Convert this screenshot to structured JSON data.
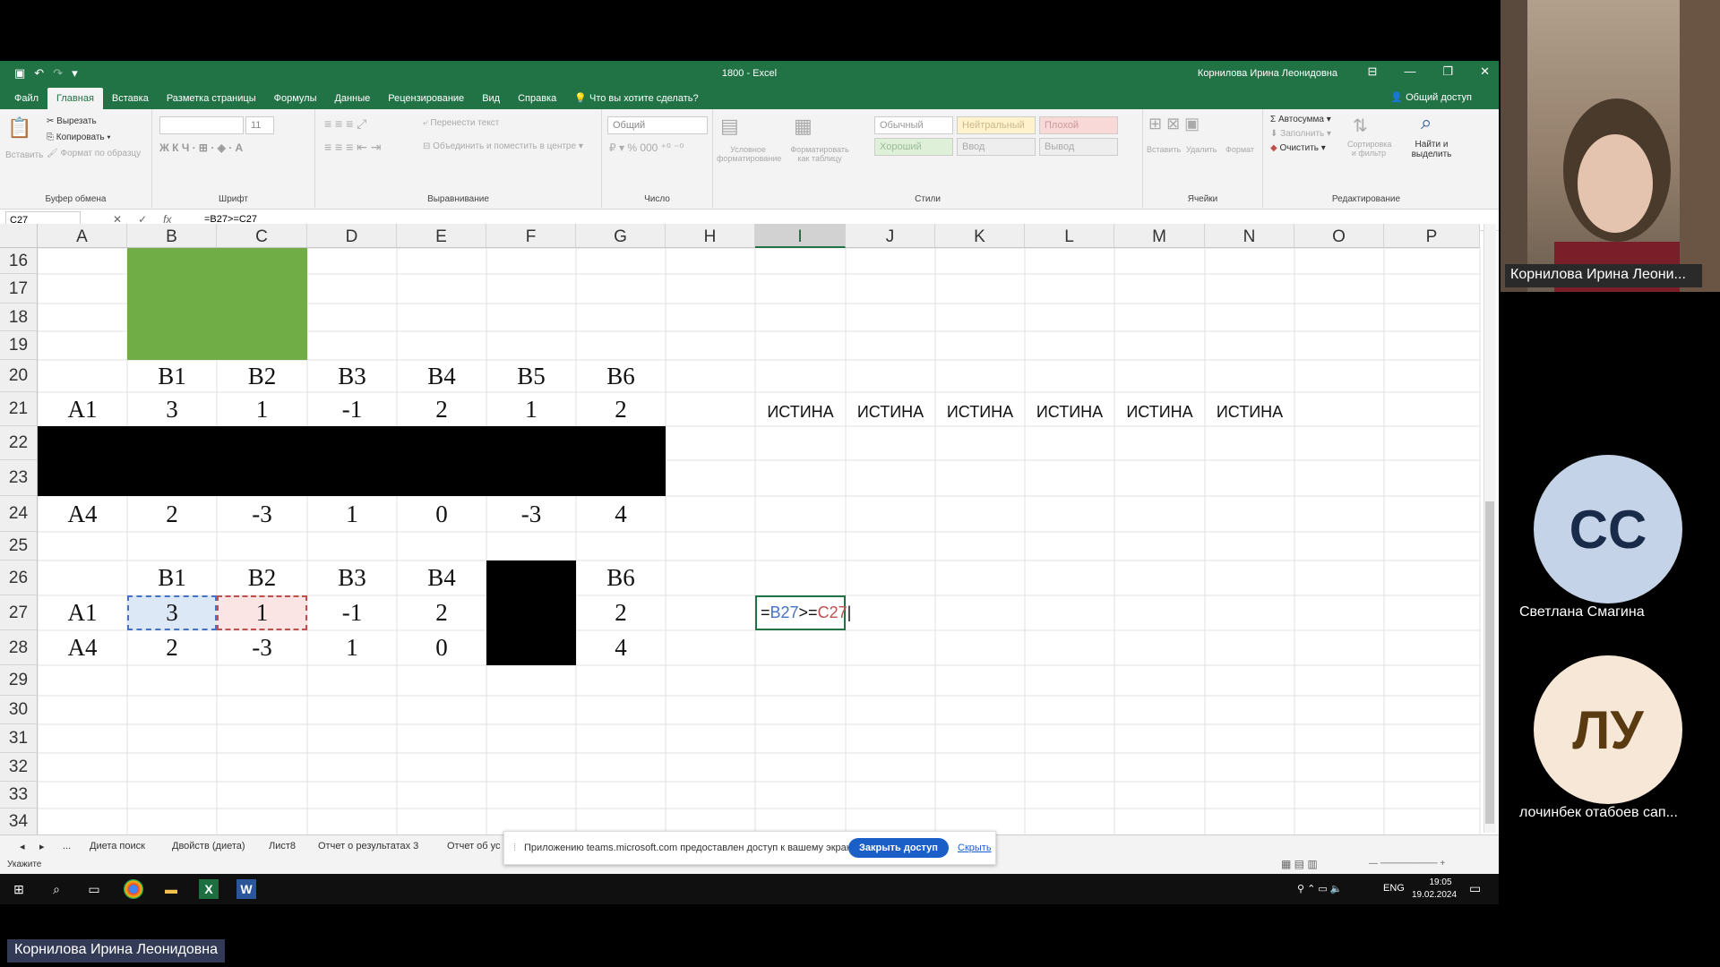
{
  "window": {
    "title": "1800  -  Excel",
    "user": "Корнилова Ирина Леонидовна"
  },
  "ribbon_tabs": [
    "Файл",
    "Главная",
    "Вставка",
    "Разметка страницы",
    "Формулы",
    "Данные",
    "Рецензирование",
    "Вид",
    "Справка",
    "Что вы хотите сделать?"
  ],
  "share_label": "Общий доступ",
  "ribbon": {
    "clipboard": {
      "label": "Буфер обмена",
      "paste": "Вставить",
      "cut": "Вырезать",
      "copy": "Копировать",
      "format": "Формат по образцу"
    },
    "font": {
      "label": "Шрифт",
      "size": "11"
    },
    "align": {
      "label": "Выравнивание",
      "wrap": "Перенести текст",
      "merge": "Объединить и поместить в центре"
    },
    "number": {
      "label": "Число",
      "format": "Общий"
    },
    "styles": {
      "label": "Стили",
      "cond": "Условное форматирование",
      "table": "Форматировать как таблицу",
      "normal": "Обычный",
      "neutral": "Нейтральный",
      "bad": "Плохой",
      "good": "Хороший",
      "input": "Ввод",
      "output": "Вывод"
    },
    "cells": {
      "label": "Ячейки",
      "insert": "Вставить",
      "delete": "Удалить",
      "format": "Формат"
    },
    "editing": {
      "label": "Редактирование",
      "autosum": "Автосумма",
      "fill": "Заполнить",
      "clear": "Очистить",
      "sort": "Сортировка и фильтр",
      "find": "Найти и выделить"
    }
  },
  "formula_bar": {
    "name_box": "C27",
    "formula": "=B27>=C27"
  },
  "columns": [
    "A",
    "B",
    "C",
    "D",
    "E",
    "F",
    "G",
    "H",
    "I",
    "J",
    "K",
    "L",
    "M",
    "N",
    "O",
    "P"
  ],
  "rows": [
    "16",
    "17",
    "18",
    "19",
    "20",
    "21",
    "22",
    "23",
    "24",
    "25",
    "26",
    "27",
    "28",
    "29",
    "30",
    "31",
    "32",
    "33",
    "34"
  ],
  "table1": {
    "headers": [
      "B1",
      "B2",
      "B3",
      "B4",
      "B5",
      "B6"
    ],
    "row_a1": {
      "label": "A1",
      "values": [
        "3",
        "1",
        "-1",
        "2",
        "1",
        "2"
      ]
    },
    "row_a4": {
      "label": "A4",
      "values": [
        "2",
        "-3",
        "1",
        "0",
        "-3",
        "4"
      ]
    }
  },
  "results_row21": [
    "ИСТИНА",
    "ИСТИНА",
    "ИСТИНА",
    "ИСТИНА",
    "ИСТИНА",
    "ИСТИНА"
  ],
  "table2": {
    "headers": [
      "B1",
      "B2",
      "B3",
      "B4",
      "",
      "B6"
    ],
    "row_a1": {
      "label": "A1",
      "values": [
        "3",
        "1",
        "-1",
        "2",
        "",
        "2"
      ]
    },
    "row_a4": {
      "label": "A4",
      "values": [
        "2",
        "-3",
        "1",
        "0",
        "",
        "4"
      ]
    }
  },
  "editing_cell": {
    "eq": "=",
    "ref1": "B27",
    "op": ">=",
    "ref2": "C27"
  },
  "sheet_tabs": [
    "...",
    "Диета поиск",
    "Двойств (диета)",
    "Лист8",
    "Отчет о результатах 3",
    "Отчет об ус"
  ],
  "status": {
    "mode": "Укажите"
  },
  "notification": {
    "text": "Приложению teams.microsoft.com предоставлен доступ к вашему экрану.",
    "stop": "Закрыть доступ",
    "hide": "Скрыть"
  },
  "taskbar": {
    "lang": "ENG",
    "time": "19:05",
    "date": "19.02.2024"
  },
  "participants": {
    "video_name": "Корнилова Ирина Леони...",
    "p1": {
      "initials": "СС",
      "name": "Светлана Смагина",
      "color": "#c5d3e8",
      "text_color": "#1a2b4a"
    },
    "p2": {
      "initials": "ЛУ",
      "name": "лочинбек отабоев сап...",
      "color": "#f6e7d7",
      "text_color": "#5a3a10"
    }
  },
  "presenter_label": "Корнилова Ирина Леонидовна"
}
